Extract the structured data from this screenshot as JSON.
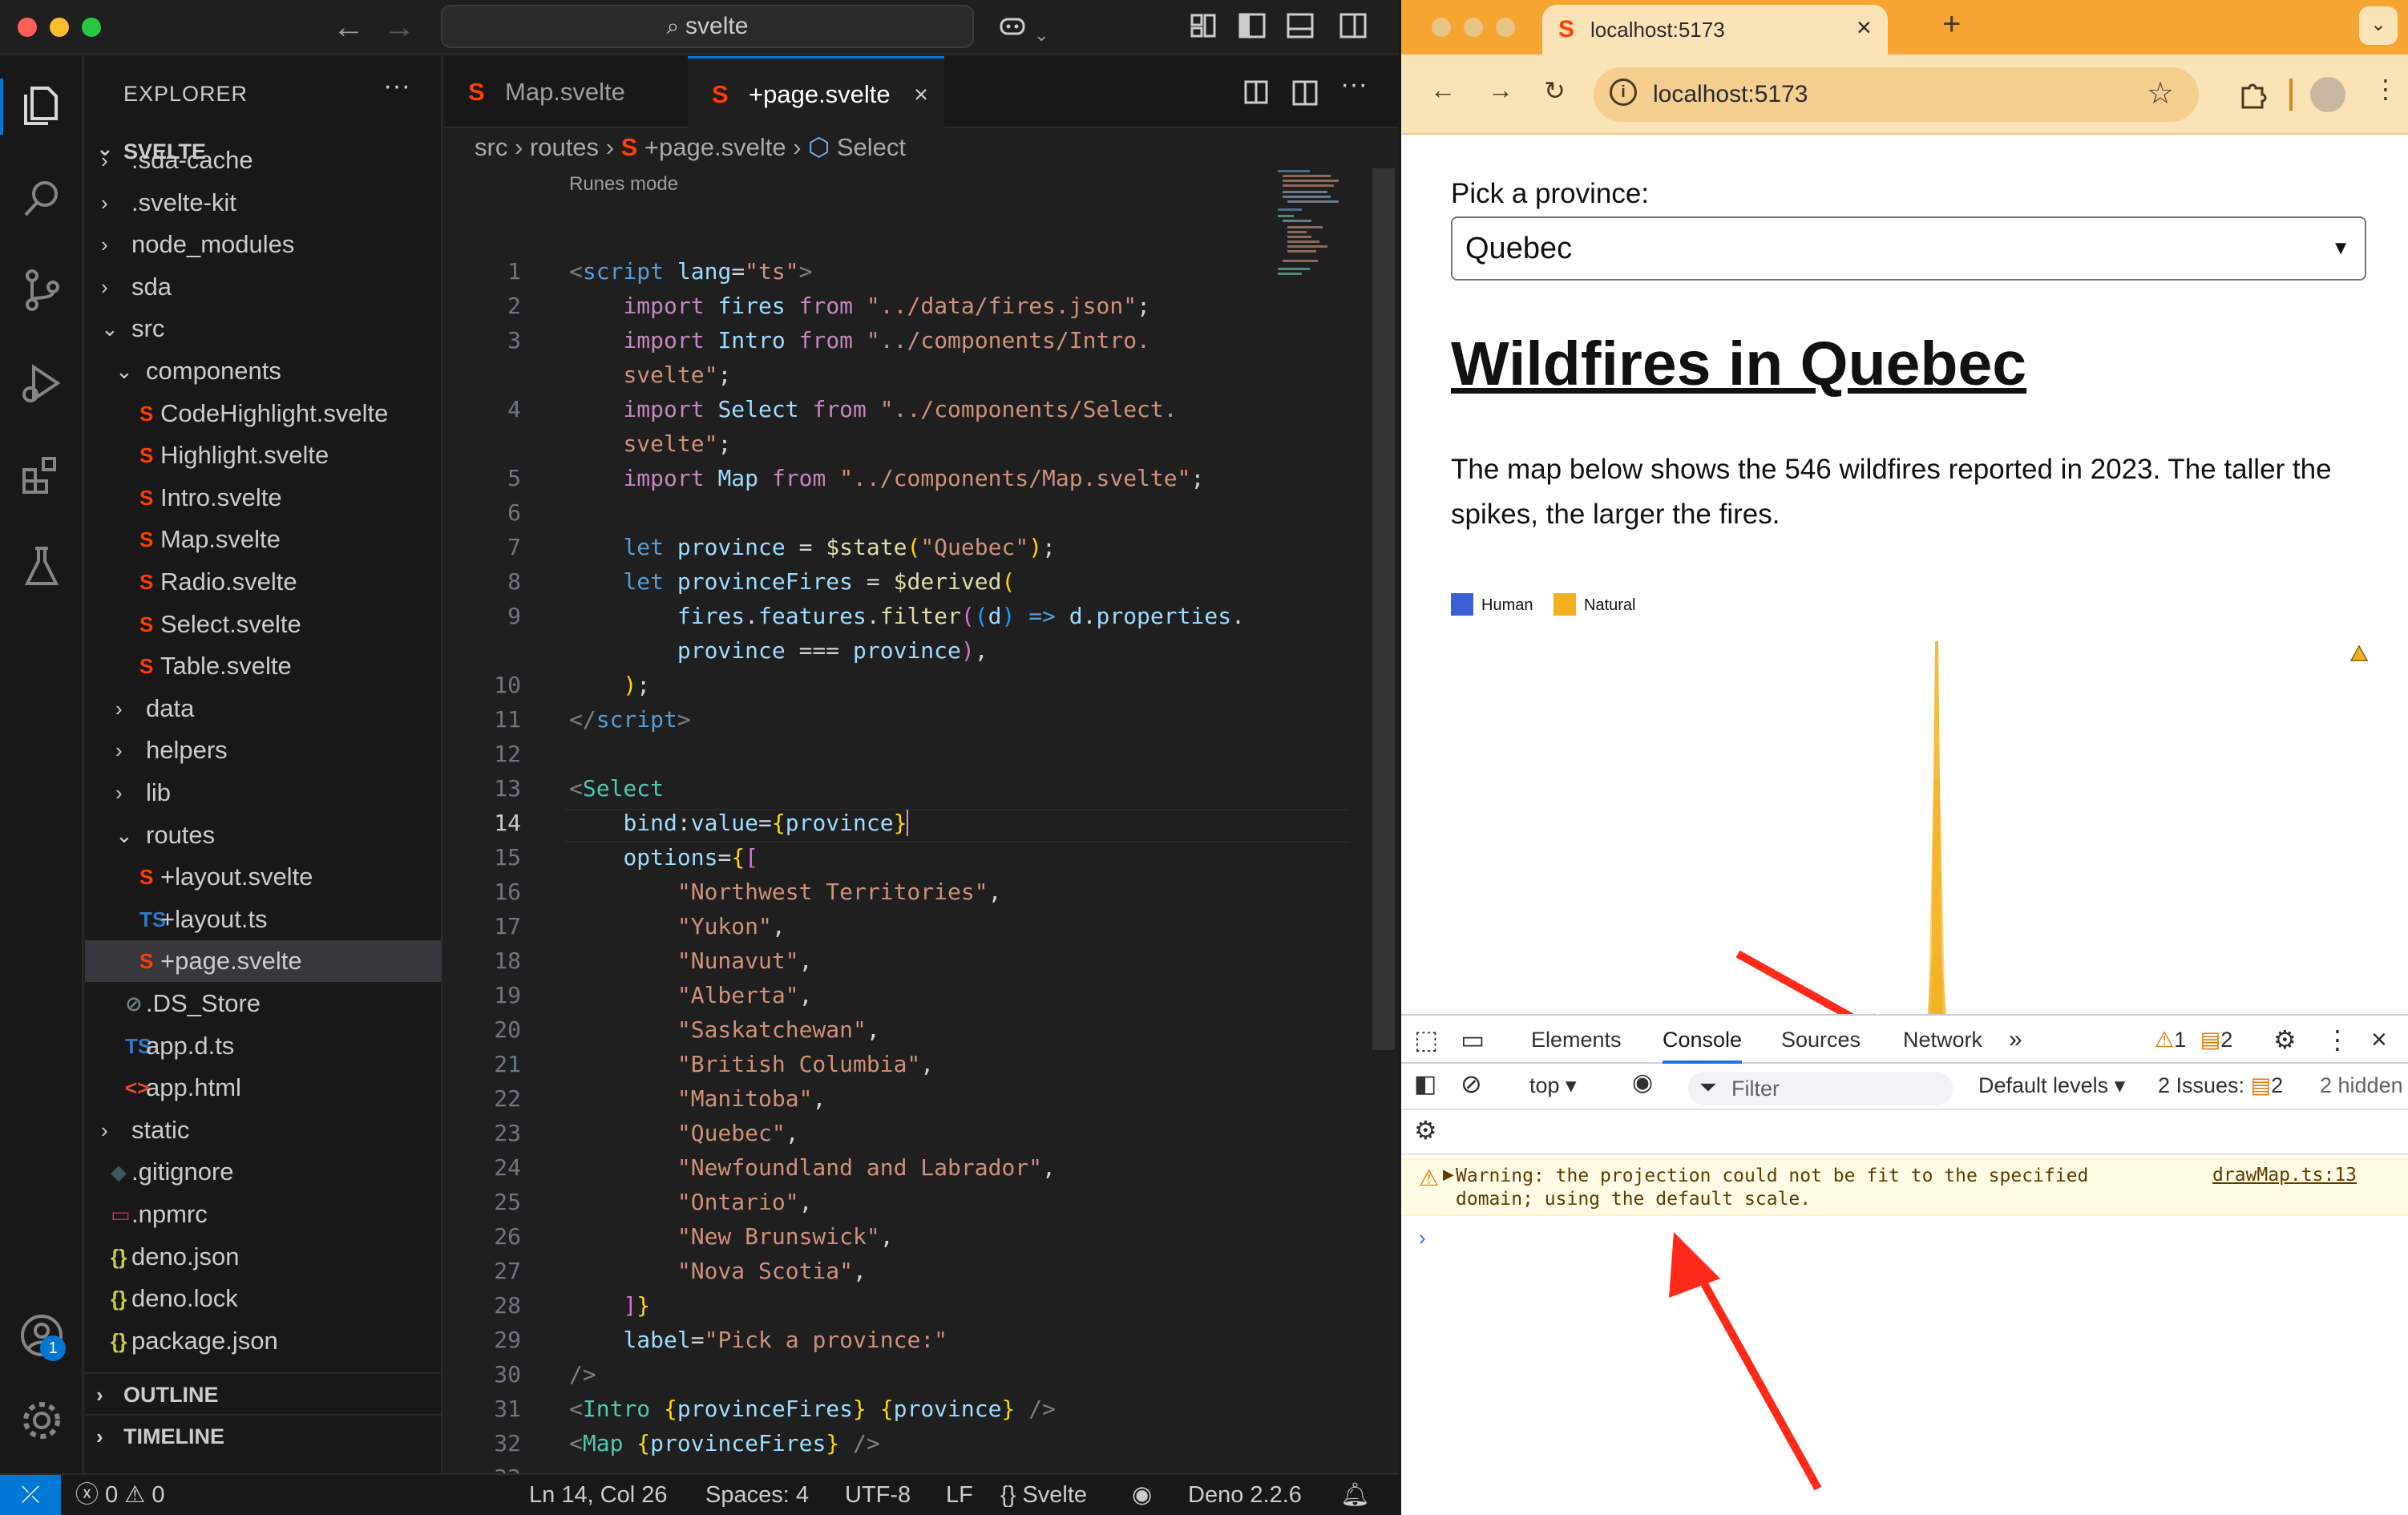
{
  "vscode": {
    "search": "svelte",
    "explorer": {
      "title": "EXPLORER",
      "more": "···",
      "root": "SVELTE"
    },
    "tree": [
      {
        "label": ".sda-cache",
        "type": "folder",
        "depth": 1
      },
      {
        "label": ".svelte-kit",
        "type": "folder",
        "depth": 1
      },
      {
        "label": "node_modules",
        "type": "folder",
        "depth": 1
      },
      {
        "label": "sda",
        "type": "folder",
        "depth": 1
      },
      {
        "label": "src",
        "type": "folder-open",
        "depth": 1
      },
      {
        "label": "components",
        "type": "folder-open",
        "depth": 2
      },
      {
        "label": "CodeHighlight.svelte",
        "type": "svelte",
        "depth": 3
      },
      {
        "label": "Highlight.svelte",
        "type": "svelte",
        "depth": 3
      },
      {
        "label": "Intro.svelte",
        "type": "svelte",
        "depth": 3
      },
      {
        "label": "Map.svelte",
        "type": "svelte",
        "depth": 3
      },
      {
        "label": "Radio.svelte",
        "type": "svelte",
        "depth": 3
      },
      {
        "label": "Select.svelte",
        "type": "svelte",
        "depth": 3
      },
      {
        "label": "Table.svelte",
        "type": "svelte",
        "depth": 3
      },
      {
        "label": "data",
        "type": "folder",
        "depth": 2
      },
      {
        "label": "helpers",
        "type": "folder",
        "depth": 2
      },
      {
        "label": "lib",
        "type": "folder",
        "depth": 2
      },
      {
        "label": "routes",
        "type": "folder-open",
        "depth": 2
      },
      {
        "label": "+layout.svelte",
        "type": "svelte",
        "depth": 3
      },
      {
        "label": "+layout.ts",
        "type": "ts",
        "depth": 3
      },
      {
        "label": "+page.svelte",
        "type": "svelte",
        "depth": 3,
        "selected": true
      },
      {
        "label": ".DS_Store",
        "type": "ds",
        "depth": 2
      },
      {
        "label": "app.d.ts",
        "type": "ts",
        "depth": 2
      },
      {
        "label": "app.html",
        "type": "html",
        "depth": 2
      },
      {
        "label": "static",
        "type": "folder",
        "depth": 1
      },
      {
        "label": ".gitignore",
        "type": "git",
        "depth": 1
      },
      {
        "label": ".npmrc",
        "type": "npm",
        "depth": 1
      },
      {
        "label": "deno.json",
        "type": "json",
        "depth": 1
      },
      {
        "label": "deno.lock",
        "type": "json",
        "depth": 1
      },
      {
        "label": "package.json",
        "type": "json",
        "depth": 1
      }
    ],
    "panels": {
      "outline": "OUTLINE",
      "timeline": "TIMELINE"
    },
    "tabs": [
      {
        "label": "Map.svelte",
        "active": false
      },
      {
        "label": "+page.svelte",
        "active": true
      }
    ],
    "breadcrumb": {
      "a": "src",
      "b": "routes",
      "c": "+page.svelte",
      "d": "Select"
    },
    "runes": "Runes mode",
    "current_line": 14,
    "status": {
      "errors": "0",
      "warnings": "0",
      "position": "Ln 14, Col 26",
      "spaces": "Spaces: 4",
      "encoding": "UTF-8",
      "eol": "LF",
      "language": "Svelte",
      "runtime": "Deno 2.2.6"
    },
    "account_badge": "1"
  },
  "chrome": {
    "tab_title": "localhost:5173",
    "url": "localhost:5173",
    "page": {
      "pick_label": "Pick a province:",
      "selected_province": "Quebec",
      "title": "Wildfires in Quebec",
      "description": "The map below shows the 546 wildfires reported in 2023. The taller the spikes, the larger the fires.",
      "legend": [
        {
          "label": "Human",
          "color": "#3b5fd4"
        },
        {
          "label": "Natural",
          "color": "#f2b01e"
        }
      ]
    },
    "devtools": {
      "tabs": [
        "Elements",
        "Console",
        "Sources",
        "Network"
      ],
      "active_tab": "Console",
      "warn_count": "1",
      "msg_count": "2",
      "context": "top",
      "filter_placeholder": "Filter",
      "levels": "Default levels",
      "issues_label": "2 Issues:",
      "issues_count": "2",
      "hidden": "2 hidden",
      "warning_text": "Warning: the projection could not be fit to the specified domain; using the default scale.",
      "warning_source": "drawMap.ts:13"
    }
  }
}
